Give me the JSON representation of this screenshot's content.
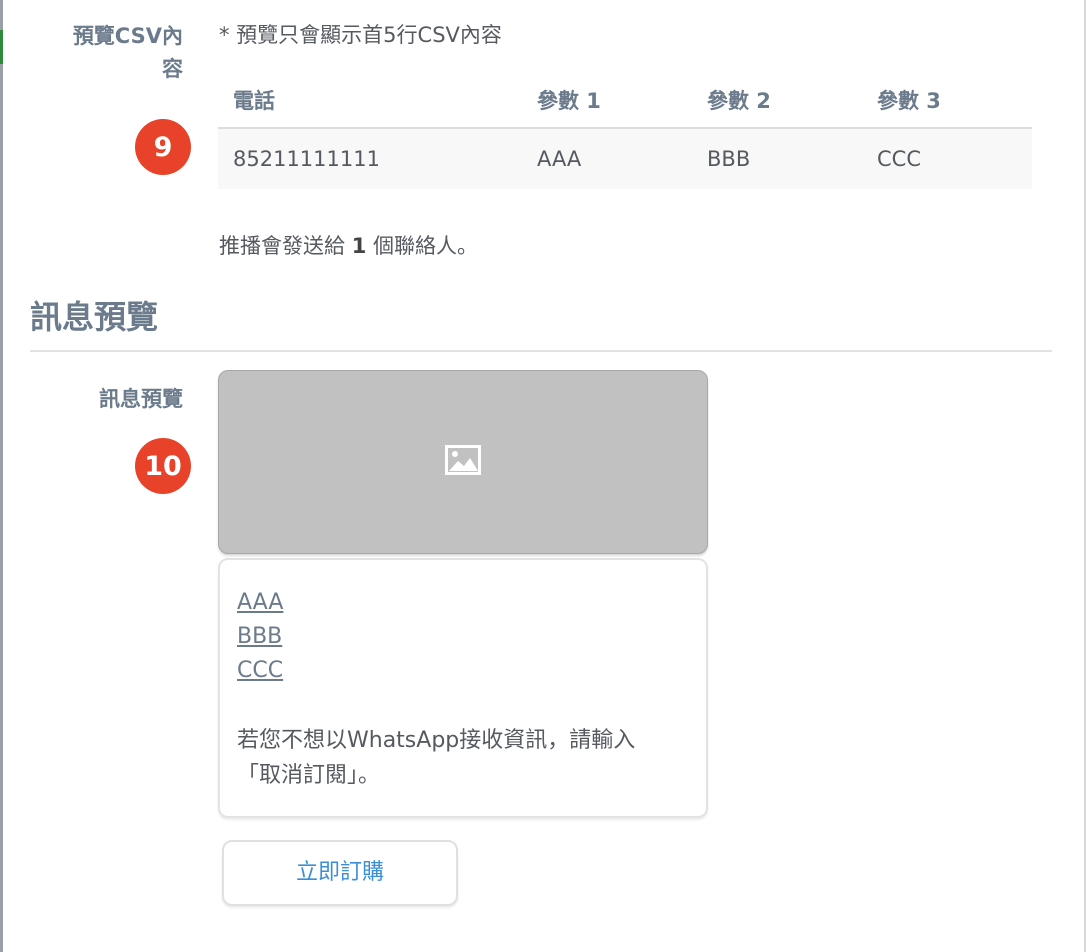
{
  "csv_preview": {
    "label": "預覽CSV內容",
    "step_number": "9",
    "note": "* 預覽只會顯示首5行CSV內容",
    "columns": [
      "電話",
      "參數 1",
      "參數 2",
      "參數 3"
    ],
    "rows": [
      [
        "85211111111",
        "AAA",
        "BBB",
        "CCC"
      ]
    ],
    "recipients_prefix": "推播會發送給",
    "recipients_count": "1",
    "recipients_suffix": "個聯絡人。"
  },
  "message_preview": {
    "section_title": "訊息預覽",
    "label": "訊息預覽",
    "step_number": "10",
    "media_icon": "image-icon",
    "links": [
      "AAA",
      "BBB",
      "CCC"
    ],
    "unsubscribe_line1": "若您不想以WhatsApp接收資訊，請輸入",
    "unsubscribe_line2": "「取消訂閱」。",
    "button_label": "立即訂購"
  },
  "colors": {
    "badge": "#e8432a",
    "label": "#6b7b8c",
    "button_text": "#3b8fd6",
    "media_placeholder": "#c1c1c1"
  }
}
